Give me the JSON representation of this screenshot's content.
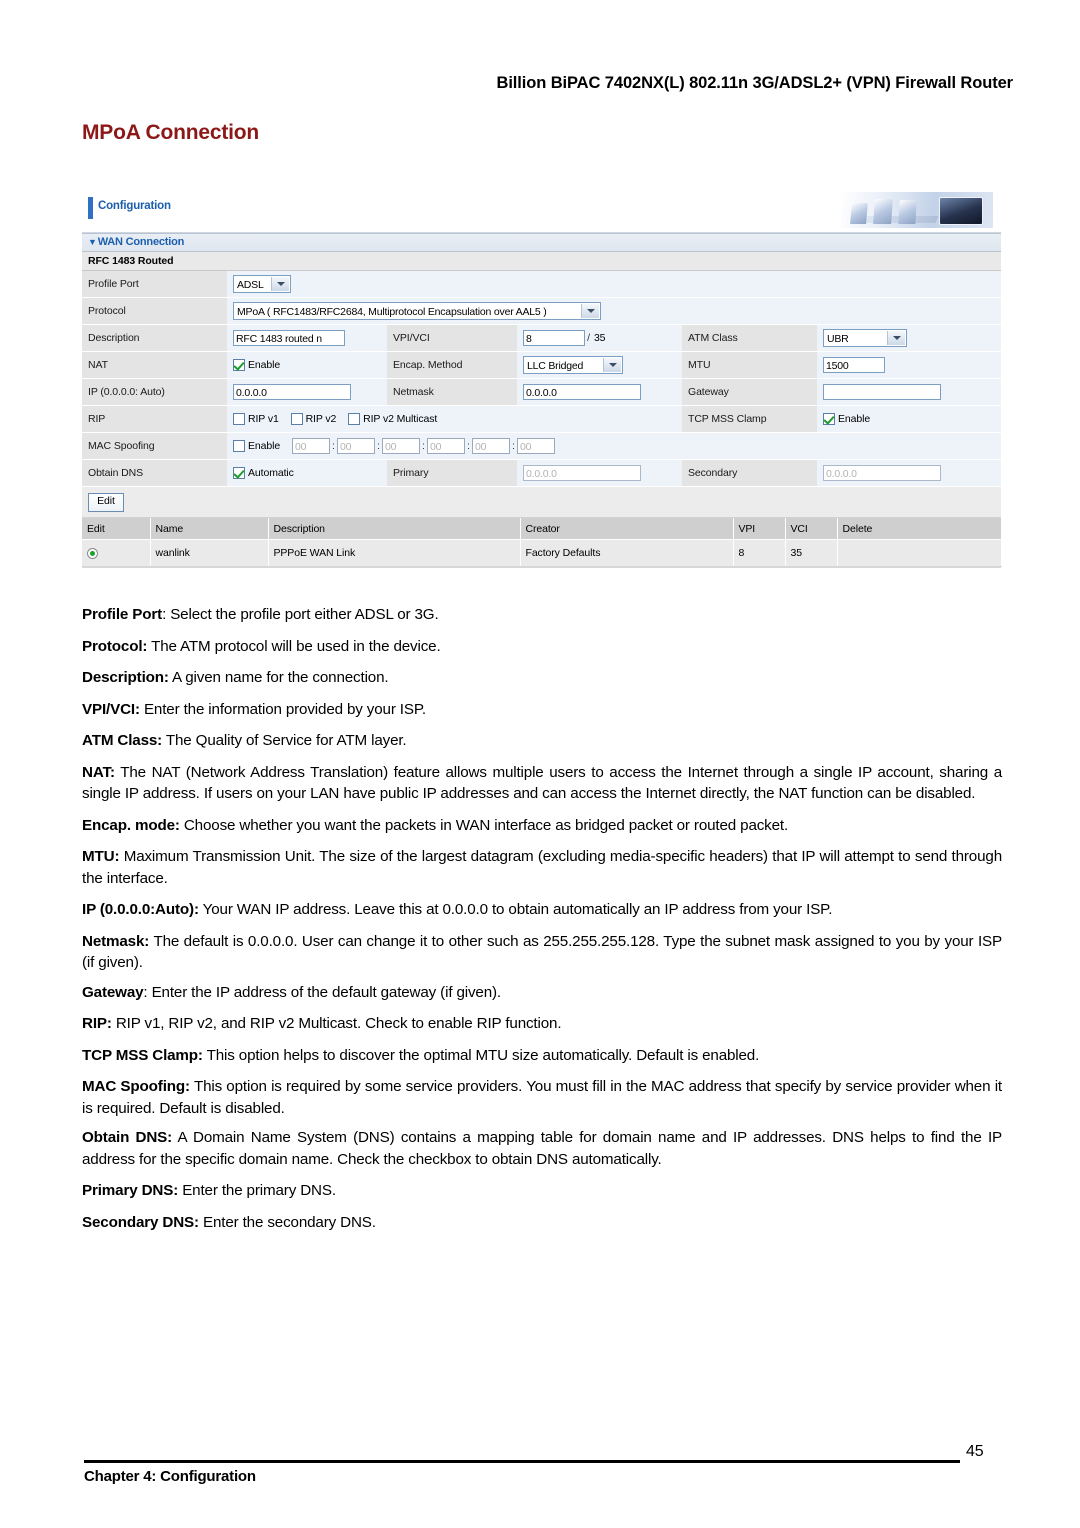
{
  "document": {
    "running_header": "Billion BiPAC 7402NX(L) 802.11n 3G/ADSL2+ (VPN) Firewall Router",
    "section_title": "MPoA Connection",
    "footer_chapter": "Chapter 4: Configuration",
    "page_number": "45",
    "accent_color": "#8c1818"
  },
  "screenshot": {
    "tab_label": "Configuration",
    "panel_title": "WAN Connection",
    "panel_caret": "▼",
    "sub_header": "RFC 1483 Routed",
    "rows": {
      "profile_port": {
        "label": "Profile Port",
        "value": "ADSL"
      },
      "protocol": {
        "label": "Protocol",
        "value": "MPoA ( RFC1483/RFC2684, Multiprotocol Encapsulation over AAL5 )"
      },
      "description": {
        "label": "Description",
        "value": "RFC 1483 routed n"
      },
      "vpi_vci": {
        "label": "VPI/VCI",
        "vpi": "8",
        "separator": "/",
        "vci": "35"
      },
      "atm_class": {
        "label": "ATM Class",
        "value": "UBR"
      },
      "nat": {
        "label": "NAT",
        "checkbox_label": "Enable",
        "checked": true
      },
      "encap_method": {
        "label": "Encap. Method",
        "value": "LLC Bridged"
      },
      "mtu": {
        "label": "MTU",
        "value": "1500"
      },
      "ip": {
        "label": "IP (0.0.0.0: Auto)",
        "value": "0.0.0.0"
      },
      "netmask": {
        "label": "Netmask",
        "value": "0.0.0.0"
      },
      "gateway": {
        "label": "Gateway",
        "value": ""
      },
      "rip": {
        "label": "RIP",
        "options": [
          {
            "label": "RIP v1",
            "checked": false
          },
          {
            "label": "RIP v2",
            "checked": false
          },
          {
            "label": "RIP v2 Multicast",
            "checked": false
          }
        ]
      },
      "tcp_mss_clamp": {
        "label": "TCP MSS Clamp",
        "checkbox_label": "Enable",
        "checked": true
      },
      "mac_spoofing": {
        "label": "MAC Spoofing",
        "checkbox_label": "Enable",
        "checked": false,
        "octets": [
          "00",
          "00",
          "00",
          "00",
          "00",
          "00"
        ],
        "octet_separator": ":"
      },
      "obtain_dns": {
        "label": "Obtain DNS",
        "checkbox_label": "Automatic",
        "checked": true
      },
      "primary_dns": {
        "label": "Primary",
        "value": "0.0.0.0"
      },
      "secondary_dns": {
        "label": "Secondary",
        "value": "0.0.0.0"
      }
    },
    "edit_button": "Edit",
    "list_table": {
      "headers": [
        "Edit",
        "Name",
        "Description",
        "Creator",
        "VPI",
        "VCI",
        "Delete"
      ],
      "rows": [
        {
          "selected": true,
          "name": "wanlink",
          "description": "PPPoE WAN Link",
          "creator": "Factory Defaults",
          "vpi": "8",
          "vci": "35",
          "delete": ""
        }
      ]
    }
  },
  "descriptions": [
    {
      "term": "Profile Port",
      "separator": ": ",
      "text": "Select the profile port either ADSL or 3G."
    },
    {
      "term": "Protocol:",
      "separator": " ",
      "text": "The ATM protocol will be used in the device."
    },
    {
      "term": "Description:",
      "separator": " ",
      "text": "A given name for the connection."
    },
    {
      "term": "VPI/VCI:",
      "separator": " ",
      "text": "Enter the information provided by your ISP."
    },
    {
      "term": "ATM Class:",
      "separator": " ",
      "text": "The Quality of Service for ATM layer."
    },
    {
      "term": "NAT:",
      "separator": " ",
      "text": "The NAT (Network Address Translation) feature allows multiple users to access the Internet through a single IP account, sharing a single IP address. If users on your LAN have public IP addresses and can access the Internet directly, the NAT function can be disabled."
    },
    {
      "term": "Encap. mode:",
      "separator": " ",
      "text": "Choose whether you want the packets in WAN interface as bridged packet or routed packet."
    },
    {
      "term": "MTU:",
      "separator": " ",
      "text": "Maximum Transmission Unit. The size of the largest datagram (excluding media-specific headers) that IP will attempt to send through the interface."
    },
    {
      "term": "IP (0.0.0.0:Auto):",
      "separator": " ",
      "text": "Your WAN IP address. Leave this at 0.0.0.0 to obtain automatically an IP address from your ISP."
    },
    {
      "term": "Netmask:",
      "separator": " ",
      "text": "The default is 0.0.0.0. User can change it to other such as 255.255.255.128. Type the subnet mask assigned to you by your ISP (if given)."
    },
    {
      "term": "Gateway",
      "separator": ": ",
      "text": "Enter the IP address of the default gateway (if given)."
    },
    {
      "term": "RIP:",
      "separator": " ",
      "text": "RIP v1, RIP v2, and RIP v2 Multicast. Check to enable RIP function."
    },
    {
      "term": "TCP MSS Clamp:",
      "separator": " ",
      "text": "This option helps to discover the optimal MTU size automatically. Default is enabled."
    },
    {
      "term": "MAC Spoofing:",
      "separator": " ",
      "text": "This option is required by some service providers. You must fill in the MAC address that specify by service provider when it is required. Default is disabled."
    },
    {
      "term": "Obtain DNS:",
      "separator": " ",
      "text": "A Domain Name System (DNS) contains a mapping table for domain name and IP addresses.  DNS helps to find the IP address for the specific domain name.  Check the checkbox to obtain DNS automatically."
    },
    {
      "term": "Primary DNS:",
      "separator": " ",
      "text": "Enter the primary DNS."
    },
    {
      "term": "Secondary DNS:",
      "separator": " ",
      "text": "Enter the secondary DNS."
    }
  ]
}
